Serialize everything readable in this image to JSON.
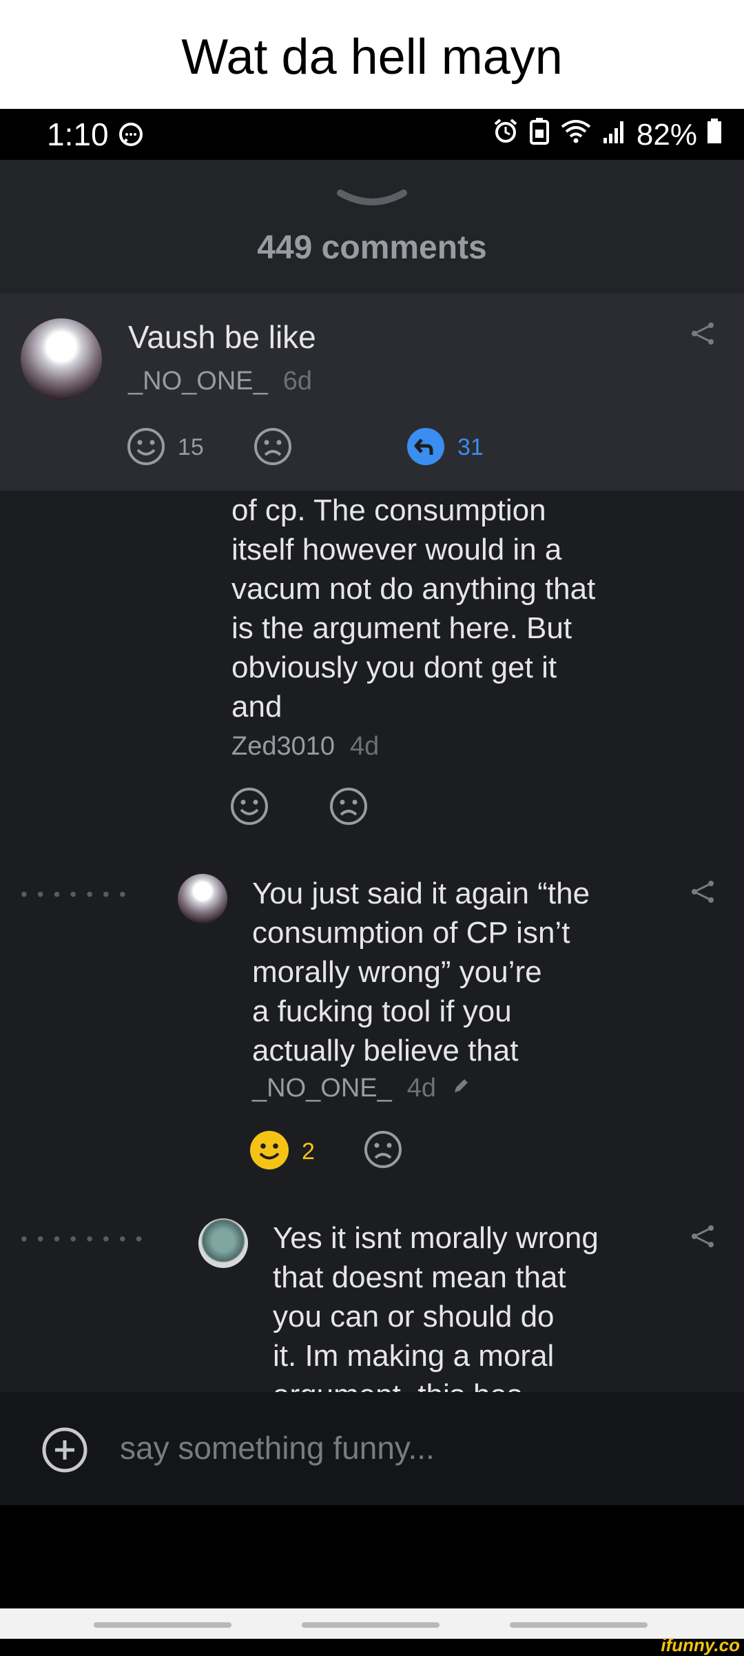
{
  "caption": "Wat da hell mayn",
  "status_bar": {
    "time": "1:10",
    "battery": "82%"
  },
  "sheet": {
    "comment_count": "449 comments"
  },
  "post": {
    "title": "Vaush be like",
    "author": "_NO_ONE_",
    "age": "6d",
    "smile_count": "15",
    "reply_count": "31"
  },
  "comments": [
    {
      "lines": [
        "of cp. The consumption",
        "itself however would in a",
        "vacum not do anything that",
        "is the argument here. But",
        "obviously you dont get it",
        "and"
      ],
      "author": "Zed3010",
      "age": "4d"
    },
    {
      "lines": [
        "You just said it again “the",
        "consumption of CP isn’t",
        "morally wrong” you’re",
        "a fucking tool if you",
        "actually believe that"
      ],
      "author": "_NO_ONE_",
      "age": "4d",
      "smile_count": "2"
    },
    {
      "lines": [
        "Yes it isnt morally wrong",
        "that doesnt mean that",
        "you can or should do",
        "it. Im making a moral",
        "argument, this has"
      ]
    }
  ],
  "input": {
    "placeholder": "say something funny..."
  },
  "watermark": "ifunny.co",
  "colors": {
    "smile_active": "#f4c316",
    "reply_blue": "#3a8ef0",
    "sheet_bg": "#1c1d21"
  }
}
